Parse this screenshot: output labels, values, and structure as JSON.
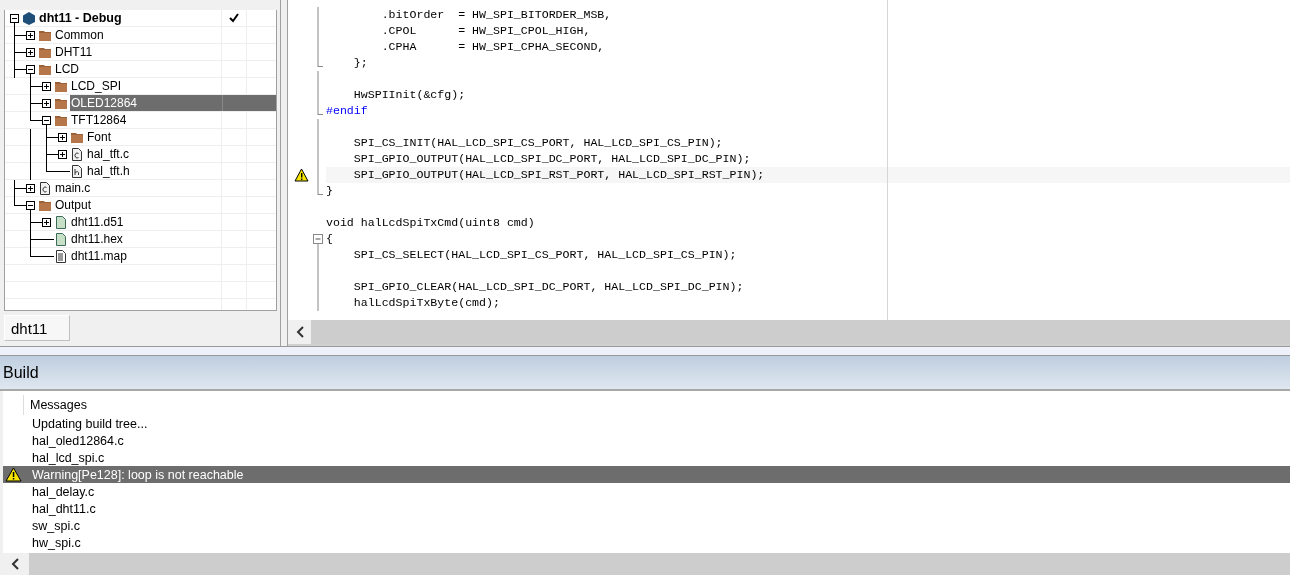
{
  "workspace": {
    "tree": [
      {
        "name": "dht11 - Debug",
        "kind": "project",
        "expanded": true,
        "selected": false,
        "checked": true,
        "children": [
          {
            "name": "Common",
            "kind": "folder",
            "expanded": false,
            "selected": false,
            "checked": false
          },
          {
            "name": "DHT11",
            "kind": "folder",
            "expanded": false,
            "selected": false,
            "checked": false
          },
          {
            "name": "LCD",
            "kind": "folder",
            "expanded": true,
            "selected": false,
            "checked": false,
            "children": [
              {
                "name": "LCD_SPI",
                "kind": "folder",
                "expanded": false,
                "selected": false,
                "checked": false
              },
              {
                "name": "OLED12864",
                "kind": "folder",
                "expanded": false,
                "selected": true,
                "checked": false
              },
              {
                "name": "TFT12864",
                "kind": "folder",
                "expanded": true,
                "selected": false,
                "checked": false,
                "children": [
                  {
                    "name": "Font",
                    "kind": "folder",
                    "expanded": false,
                    "selected": false,
                    "checked": false
                  },
                  {
                    "name": "hal_tft.c",
                    "kind": "c-file",
                    "expanded": false,
                    "selected": false,
                    "checked": false
                  },
                  {
                    "name": "hal_tft.h",
                    "kind": "h-file",
                    "selected": false,
                    "checked": false
                  }
                ]
              }
            ]
          },
          {
            "name": "main.c",
            "kind": "c-file",
            "expanded": false,
            "selected": false,
            "checked": false
          },
          {
            "name": "Output",
            "kind": "folder",
            "expanded": true,
            "selected": false,
            "checked": false,
            "children": [
              {
                "name": "dht11.d51",
                "kind": "data-file",
                "expanded": false,
                "selected": false,
                "checked": false
              },
              {
                "name": "dht11.hex",
                "kind": "data-file",
                "selected": false,
                "checked": false
              },
              {
                "name": "dht11.map",
                "kind": "text-file",
                "selected": false,
                "checked": false
              }
            ]
          }
        ]
      }
    ],
    "tabs": [
      {
        "label": "dht11",
        "selected": true
      }
    ]
  },
  "editor": {
    "lines": [
      {
        "text": "        .bitOrder  = HW_SPI_BITORDER_MSB,",
        "kind": "code",
        "warning": false
      },
      {
        "text": "        .CPOL      = HW_SPI_CPOL_HIGH,",
        "kind": "code",
        "warning": false
      },
      {
        "text": "        .CPHA      = HW_SPI_CPHA_SECOND,",
        "kind": "code",
        "warning": false
      },
      {
        "text": "    };",
        "kind": "block-end",
        "warning": false
      },
      {
        "kind": "code",
        "warning": false
      },
      {
        "text": "    HwSPIInit(&cfg);",
        "kind": "code",
        "warning": false
      },
      {
        "text": "#endif",
        "kind": "directive-end",
        "warning": false
      },
      {
        "kind": "code",
        "warning": false
      },
      {
        "text": "    SPI_CS_INIT(HAL_LCD_SPI_CS_PORT, HAL_LCD_SPI_CS_PIN);",
        "kind": "code",
        "warning": false
      },
      {
        "text": "    SPI_GPIO_OUTPUT(HAL_LCD_SPI_DC_PORT, HAL_LCD_SPI_DC_PIN);",
        "kind": "code",
        "warning": false
      },
      {
        "text": "    SPI_GPIO_OUTPUT(HAL_LCD_SPI_RST_PORT, HAL_LCD_SPI_RST_PIN);",
        "kind": "code",
        "warning": true
      },
      {
        "text": "}",
        "kind": "block-end",
        "warning": false
      },
      {
        "kind": "outside",
        "warning": false
      },
      {
        "text": "void halLcdSpiTxCmd(uint8 cmd)",
        "kind": "outside",
        "warning": false
      },
      {
        "text": "{",
        "kind": "block-start",
        "warning": false
      },
      {
        "text": "    SPI_CS_SELECT(HAL_LCD_SPI_CS_PORT, HAL_LCD_SPI_CS_PIN);",
        "kind": "code",
        "warning": false
      },
      {
        "kind": "code",
        "warning": false
      },
      {
        "text": "    SPI_GPIO_CLEAR(HAL_LCD_SPI_DC_PORT, HAL_LCD_SPI_DC_PIN);",
        "kind": "code",
        "warning": false
      },
      {
        "text": "    halLcdSpiTxByte(cmd);",
        "kind": "code",
        "warning": false
      }
    ]
  },
  "build": {
    "title": "Build",
    "column": "Messages",
    "messages": [
      {
        "text": "Updating build tree...",
        "kind": "info",
        "selected": false
      },
      {
        "text": "hal_oled12864.c",
        "kind": "info",
        "selected": false
      },
      {
        "text": "hal_lcd_spi.c",
        "kind": "info",
        "selected": false
      },
      {
        "text": "Warning[Pe128]: loop is not reachable",
        "kind": "warning",
        "selected": true
      },
      {
        "text": "hal_delay.c",
        "kind": "info",
        "selected": false
      },
      {
        "text": "hal_dht11.c",
        "kind": "info",
        "selected": false
      },
      {
        "text": "sw_spi.c",
        "kind": "info",
        "selected": false
      },
      {
        "text": "hw_spi.c",
        "kind": "info",
        "selected": false
      }
    ]
  }
}
